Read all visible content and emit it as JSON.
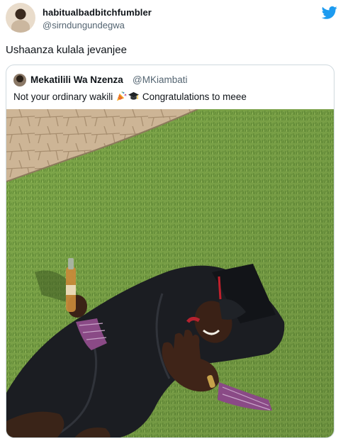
{
  "tweet": {
    "author_name": "habitualbadbitchfumbler",
    "author_handle": "@sirndungundegwa",
    "text": "Ushaanza kulala jevanjee",
    "logo_icon": "twitter-bird-icon",
    "brand_color": "#1d9bf0"
  },
  "quoted_tweet": {
    "author_name": "Mekatilili Wa Nzenza",
    "author_handle": "@MKiambati",
    "text_before": "Not your ordinary wakili ",
    "emojis": [
      "party-popper-emoji",
      "graduation-cap-emoji"
    ],
    "text_after": " Congratulations to meee",
    "image": "photo-graduate-lying-on-grass"
  }
}
